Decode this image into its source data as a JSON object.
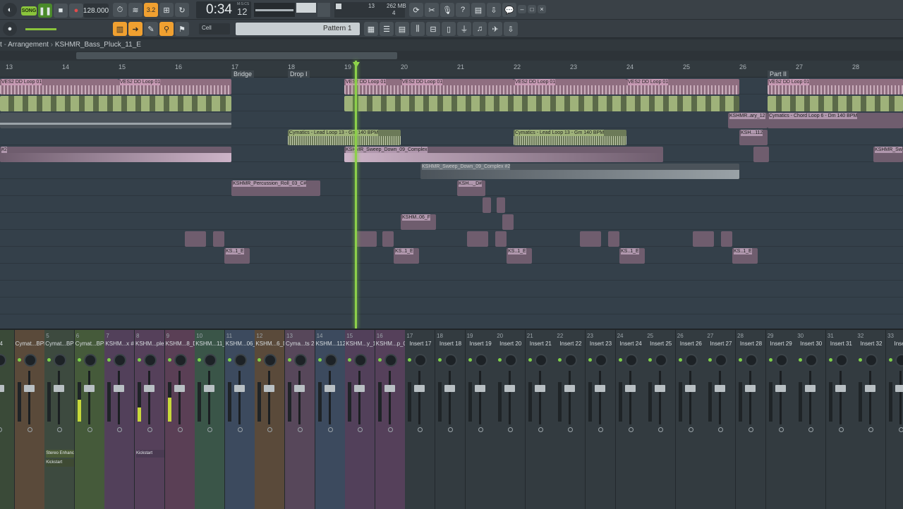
{
  "toolbar": {
    "mode_label": "SONG",
    "tempo": "128.000",
    "pattern_counter": "3.2",
    "time_main": "0:34",
    "time_sub": "12",
    "time_unit": "M:S:CS",
    "cpu_value": "13",
    "ram_value": "262 MB",
    "voices": "4",
    "snap_label": "Cell",
    "pattern_label": "Pattern 1"
  },
  "breadcrumb": {
    "items": [
      "t",
      "Arrangement",
      "KSHMR_Bass_Pluck_11_E"
    ]
  },
  "ruler": {
    "bars": [
      "13",
      "14",
      "15",
      "16",
      "17",
      "18",
      "19",
      "20",
      "21",
      "22",
      "23",
      "24",
      "25",
      "26",
      "27",
      "28"
    ],
    "markers": [
      "Bridge",
      "Drop I",
      "Part II"
    ]
  },
  "clips": {
    "ves2_a": "VES2 DD Loop 01",
    "ves2_b": "VES2 DD Loop 01",
    "ves2_c": "VES2 DD Loop 01",
    "ves2_d": "VES2 DD Loop 01",
    "ves2_e": "VES2 DD Loop 01",
    "ves2_f": "VES2 DD Loop 01",
    "ves2_g": "VES2 DD Loop 01",
    "chord_short": "KSHMR..ary_12",
    "chord": "Cymatics - Chord Loop 6 - Dm 140 BPM",
    "lead_a": "Cymatics - Lead Loop 13 - Gm 140 BPM",
    "lead_b": "Cymatics - Lead Loop 13 - Gm 140 BPM",
    "kshmr_112": "KSH...112",
    "sweep_left": "#2",
    "sweep": "KSHMR_Sweep_Down_09_Complex",
    "sweep_right": "KSHMR_Sw",
    "sweep_2": "KSHMR_Sweep_Down_09_Complex #2",
    "perc_roll": "KSHMR_Percussion_Roll_03_C#",
    "ksh_d": "KSH..._D#",
    "ksh_06": "KSHM..06_F",
    "ks_e1": "KS..1_E",
    "ks_e2": "KS..1_E",
    "ks_e3": "KS..1_E",
    "ks_e4": "KS..1_E",
    "ks_e5": "KS..1_E"
  },
  "mixer": {
    "strips": [
      {
        "num": "",
        "name": "04"
      },
      {
        "num": "",
        "name": "Cymat...BPM"
      },
      {
        "num": "5",
        "name": "Cymat...BPM"
      },
      {
        "num": "6",
        "name": "Cymat...BPM"
      },
      {
        "num": "7",
        "name": "KSHM...x #2"
      },
      {
        "num": "8",
        "name": "KSHM...plex"
      },
      {
        "num": "9",
        "name": "KSHM...8_D#"
      },
      {
        "num": "10",
        "name": "KSHM...11_E"
      },
      {
        "num": "11",
        "name": "KSHM...06_F"
      },
      {
        "num": "12",
        "name": "KSHM...6_D#"
      },
      {
        "num": "13",
        "name": "Cyma...ts 28"
      },
      {
        "num": "14",
        "name": "KSHM...112"
      },
      {
        "num": "15",
        "name": "KSHM...y_12"
      },
      {
        "num": "16",
        "name": "KSHM...p_03"
      },
      {
        "num": "17",
        "name": "Insert 17"
      },
      {
        "num": "18",
        "name": "Insert 18"
      },
      {
        "num": "19",
        "name": "Insert 19"
      },
      {
        "num": "20",
        "name": "Insert 20"
      },
      {
        "num": "21",
        "name": "Insert 21"
      },
      {
        "num": "22",
        "name": "Insert 22"
      },
      {
        "num": "23",
        "name": "Insert 23"
      },
      {
        "num": "24",
        "name": "Insert 24"
      },
      {
        "num": "25",
        "name": "Insert 25"
      },
      {
        "num": "26",
        "name": "Insert 26"
      },
      {
        "num": "27",
        "name": "Insert 27"
      },
      {
        "num": "28",
        "name": "Insert 28"
      },
      {
        "num": "29",
        "name": "Insert 29"
      },
      {
        "num": "30",
        "name": "Insert 30"
      },
      {
        "num": "31",
        "name": "Insert 31"
      },
      {
        "num": "32",
        "name": "Insert 32"
      },
      {
        "num": "33",
        "name": "Insert"
      }
    ],
    "fx_stereo": "Stereo Enhancer",
    "fx_kick_a": "Kickstart",
    "fx_kick_b": "Kickstart"
  },
  "colors": {
    "accent": "#f0a030",
    "playhead": "#8dd04a",
    "meter": "#c8d93a"
  }
}
